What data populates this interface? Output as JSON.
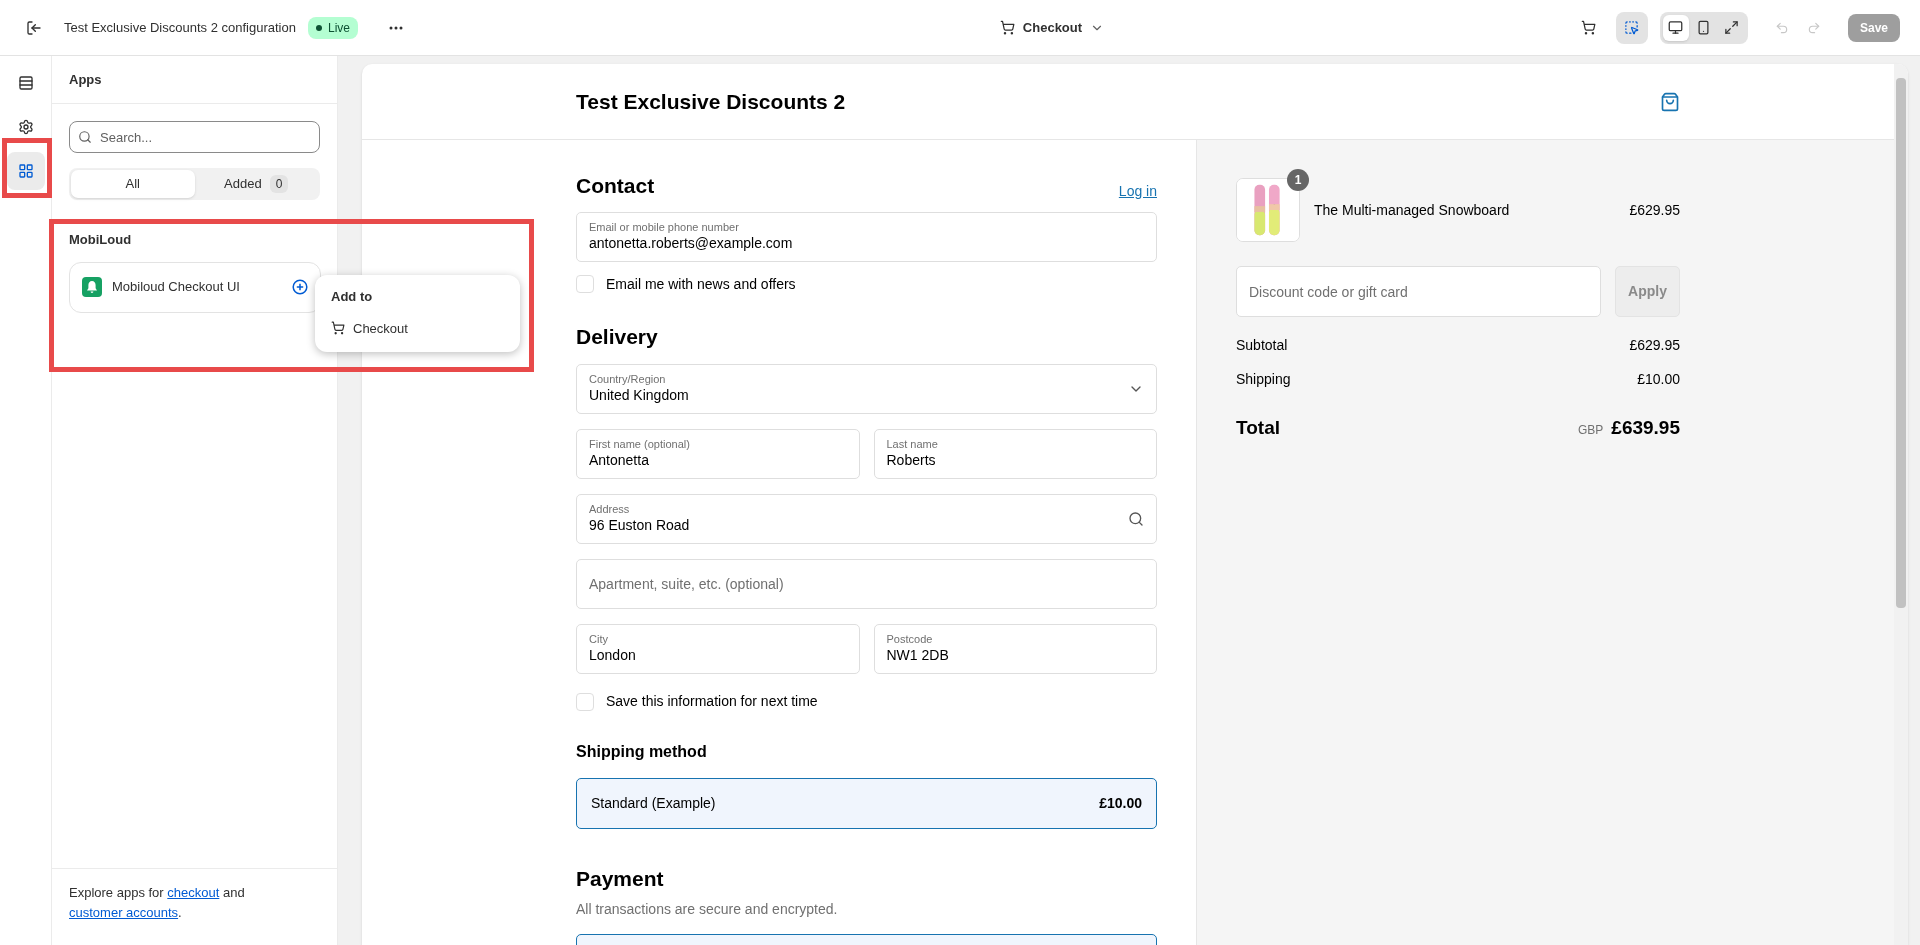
{
  "topbar": {
    "title": "Test Exclusive Discounts 2 configuration",
    "status": "Live",
    "page_selector": "Checkout",
    "inspector_active": true,
    "view_modes": [
      {
        "kind": "desktop",
        "selected": true
      },
      {
        "kind": "mobile",
        "selected": false
      },
      {
        "kind": "fullwidth",
        "selected": false
      }
    ],
    "undo_disabled": true,
    "redo_disabled": true,
    "save": {
      "label": "Save",
      "disabled": true
    }
  },
  "rail": [
    {
      "kind": "sections",
      "selected": false
    },
    {
      "kind": "settings",
      "selected": false
    },
    {
      "kind": "apps",
      "selected": true
    }
  ],
  "sidebar": {
    "title": "Apps",
    "search": {
      "placeholder": "Search..."
    },
    "filters": [
      {
        "label": "All",
        "selected": true
      },
      {
        "label": "Added",
        "count": "0",
        "selected": false
      }
    ],
    "groups": [
      {
        "name": "MobiLoud",
        "apps": [
          {
            "name": "Mobiloud Checkout UI"
          }
        ]
      }
    ],
    "popup": {
      "title": "Add to",
      "items": [
        {
          "label": "Checkout"
        }
      ]
    },
    "footer": {
      "before": "Explore apps for ",
      "link_1": "checkout",
      "middle": " and ",
      "link_2": "customer accounts",
      "after": "."
    }
  },
  "checkout": {
    "store_name": "Test Exclusive Discounts 2",
    "contact": {
      "heading": "Contact",
      "login": "Log in",
      "email": {
        "label": "Email or mobile phone number",
        "value": "antonetta.roberts@example.com"
      },
      "newsletter": {
        "label": "Email me with news and offers",
        "checked": false
      }
    },
    "delivery": {
      "heading": "Delivery",
      "rows": [
        {
          "fields": [
            {
              "kind": "select",
              "label": "Country/Region",
              "value": "United Kingdom"
            }
          ]
        },
        {
          "fields": [
            {
              "kind": "text",
              "label": "First name (optional)",
              "value": "Antonetta"
            },
            {
              "kind": "text",
              "label": "Last name",
              "value": "Roberts"
            }
          ]
        },
        {
          "fields": [
            {
              "kind": "search",
              "label": "Address",
              "value": "96 Euston Road"
            }
          ]
        },
        {
          "fields": [
            {
              "kind": "empty",
              "placeholder": "Apartment, suite, etc. (optional)"
            }
          ]
        },
        {
          "fields": [
            {
              "kind": "text",
              "label": "City",
              "value": "London"
            },
            {
              "kind": "text",
              "label": "Postcode",
              "value": "NW1 2DB"
            }
          ]
        }
      ],
      "save_info": {
        "label": "Save this information for next time",
        "checked": false
      }
    },
    "shipping": {
      "heading": "Shipping method",
      "options": [
        {
          "label": "Standard (Example)",
          "price": "£10.00",
          "selected": true
        }
      ]
    },
    "payment": {
      "heading": "Payment",
      "note": "All transactions are secure and encrypted.",
      "methods": [
        {
          "selected": true
        }
      ]
    }
  },
  "summary": {
    "items": [
      {
        "name": "The Multi-managed Snowboard",
        "price": "£629.95",
        "quantity": "1"
      }
    ],
    "discount": {
      "placeholder": "Discount code or gift card",
      "apply": "Apply",
      "apply_disabled": true
    },
    "lines": [
      {
        "label": "Subtotal",
        "value": "£629.95"
      },
      {
        "label": "Shipping",
        "value": "£10.00"
      }
    ],
    "total": {
      "label": "Total",
      "currency": "GBP",
      "value": "£639.95"
    }
  }
}
